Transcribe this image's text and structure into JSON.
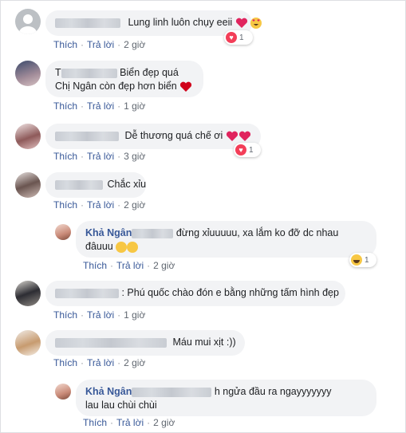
{
  "comments": [
    {
      "text": "Lung linh luôn chụy eeii",
      "likes": "1",
      "time": "2 giờ"
    },
    {
      "name_visible": "T",
      "line1": "Biển đẹp quá",
      "line2": "Chị Ngân còn đẹp hơn biển",
      "time": "1 giờ"
    },
    {
      "text": "Dễ thương quá chế ơi",
      "likes": "1",
      "time": "3 giờ"
    },
    {
      "text": "Chắc xỉu",
      "time": "2 giờ"
    },
    {
      "name": "Khả Ngân",
      "line1": "đừng xỉuuuuu, xa lắm ko đỡ dc nhau",
      "line2": "đâuuu",
      "likes": "1",
      "time": "2 giờ"
    },
    {
      "text": ": Phú quốc chào đón e bằng những tấm hình đẹp",
      "time": "1 giờ"
    },
    {
      "text": "Máu mui xịt :))",
      "time": "2 giờ"
    },
    {
      "name": "Khả Ngân",
      "line1": "h ngửa đầu ra ngayyyyyyy",
      "line2": "lau lau chùi chùi",
      "time": "2 giờ"
    }
  ],
  "labels": {
    "like": "Thích",
    "reply": "Trả lời",
    "dot": "·"
  },
  "colors": {
    "bubble": "#f2f3f5",
    "link": "#385898",
    "heart": "#f33e58",
    "emoji": "#f7c744"
  }
}
